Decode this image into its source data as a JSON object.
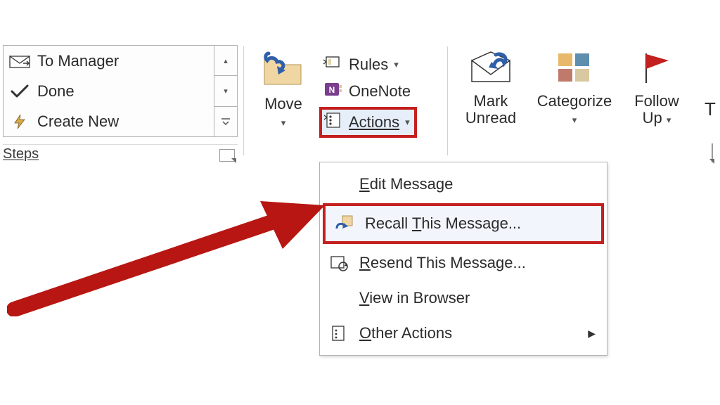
{
  "quick_steps": {
    "items": [
      {
        "name": "to-manager",
        "label": "To Manager"
      },
      {
        "name": "done",
        "label": "Done"
      },
      {
        "name": "create-new",
        "label": "Create New"
      }
    ],
    "group_label": "Steps"
  },
  "move_group": {
    "move_label": "Move",
    "rules_label": "Rules",
    "onenote_label": "OneNote",
    "actions_label": "Actions"
  },
  "tags_group": {
    "mark_unread_label_line1": "Mark",
    "mark_unread_label_line2": "Unread",
    "categorize_label": "Categorize",
    "followup_label_line1": "Follow",
    "followup_label_line2": "Up"
  },
  "actions_menu": {
    "edit_message": "Edit Message",
    "recall": "Recall This Message...",
    "resend": "Resend This Message...",
    "view_browser": "View in Browser",
    "other_actions": "Other Actions"
  },
  "accent_color": "#c3201f"
}
